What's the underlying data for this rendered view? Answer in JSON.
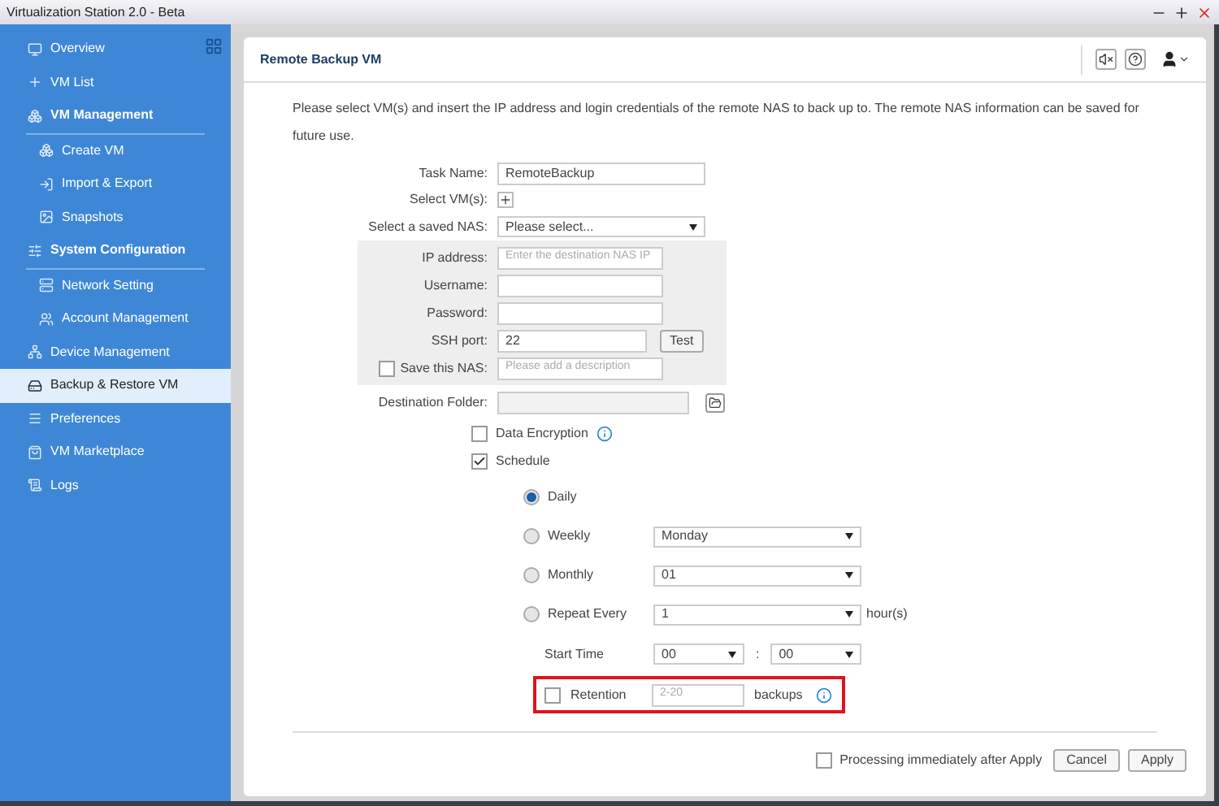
{
  "window": {
    "title": "Virtualization Station 2.0 - Beta"
  },
  "sidebar": {
    "items": [
      {
        "label": "Overview",
        "selected": false
      },
      {
        "label": "VM List",
        "selected": false
      },
      {
        "label": "VM Management",
        "selected": false,
        "children": [
          {
            "label": "Create VM",
            "selected": false
          },
          {
            "label": "Import & Export",
            "selected": false
          },
          {
            "label": "Snapshots",
            "selected": false
          }
        ]
      },
      {
        "label": "System Configuration",
        "selected": false,
        "children": [
          {
            "label": "Network Setting",
            "selected": false
          },
          {
            "label": "Account Management",
            "selected": false
          }
        ]
      },
      {
        "label": "Device Management",
        "selected": false
      },
      {
        "label": "Backup & Restore VM",
        "selected": true
      },
      {
        "label": "Preferences",
        "selected": false
      },
      {
        "label": "VM Marketplace",
        "selected": false
      },
      {
        "label": "Logs",
        "selected": false
      }
    ]
  },
  "panel": {
    "title": "Remote Backup VM",
    "description": "Please select VM(s) and insert the IP address and login credentials of the remote NAS to back up to. The remote NAS information can be saved for future use."
  },
  "form": {
    "task_name": {
      "label": "Task Name:",
      "value": "RemoteBackup"
    },
    "select_vms": {
      "label": "Select VM(s):"
    },
    "saved_nas": {
      "label": "Select a saved NAS:",
      "value": "Please select..."
    },
    "nas_fields": [
      {
        "label": "IP address:",
        "placeholder": "Enter the destination NAS IP"
      },
      {
        "label": "Username:"
      },
      {
        "label": "Password:"
      },
      {
        "label": "SSH port:",
        "value": "22",
        "button": "Test"
      }
    ],
    "save_nas": {
      "label": "Save this NAS:",
      "checked": false,
      "placeholder": "Please add a description"
    },
    "destination_folder": {
      "label": "Destination Folder:"
    },
    "data_encryption": {
      "label": "Data Encryption",
      "checked": false
    },
    "schedule": {
      "label": "Schedule",
      "checked": true
    },
    "schedule_options": [
      {
        "label": "Daily",
        "selected": true
      },
      {
        "label": "Weekly",
        "selected": false,
        "value": "Monday"
      },
      {
        "label": "Monthly",
        "selected": false,
        "value": "01"
      },
      {
        "label": "Repeat Every",
        "selected": false,
        "value": "1",
        "unit": "hour(s)"
      }
    ],
    "start_time": {
      "label": "Start Time",
      "hour": "00",
      "separator": ":",
      "minute": "00"
    },
    "retention": {
      "label": "Retention",
      "checked": false,
      "placeholder": "2-20",
      "unit": "backups"
    }
  },
  "footer": {
    "processing": {
      "label": "Processing immediately after Apply",
      "checked": false
    },
    "buttons": [
      "Cancel",
      "Apply"
    ]
  }
}
